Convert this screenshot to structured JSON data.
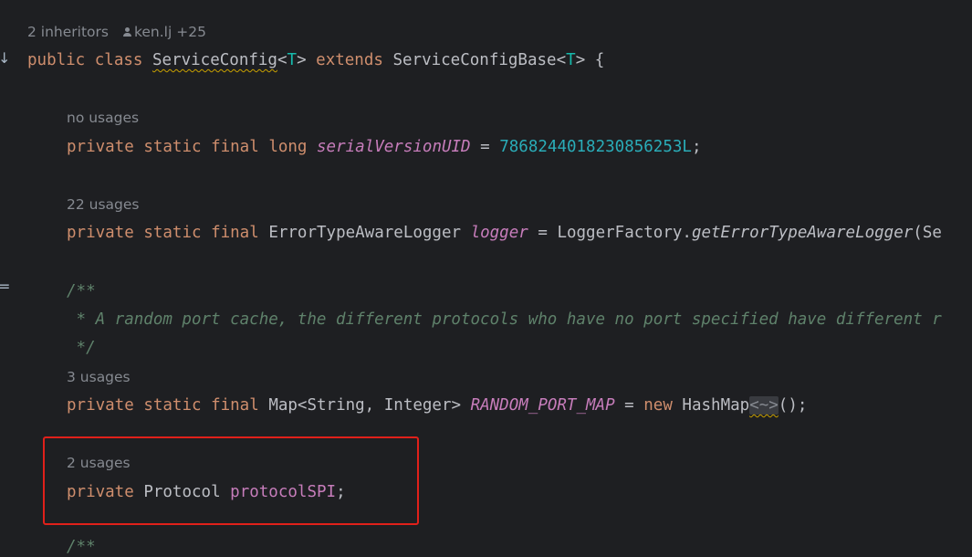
{
  "gutter": {
    "arrow_glyph": "↓",
    "impl_glyph": "="
  },
  "hints": {
    "inheritors": "2 inheritors",
    "author": "ken.lj +25",
    "usages_serial": "no usages",
    "usages_logger": "22 usages",
    "usages_map": "3 usages",
    "usages_protocol": "2 usages"
  },
  "code": {
    "class_decl": {
      "public": "public",
      "class": "class",
      "name": "ServiceConfig",
      "lt": "<",
      "tparam": "T",
      "gt": ">",
      "extends": "extends",
      "base": "ServiceConfigBase",
      "base_lt": "<",
      "base_tparam": "T",
      "base_gt": ">",
      "brace": "{"
    },
    "serial": {
      "private": "private",
      "static": "static",
      "final": "final",
      "type": "long",
      "name": "serialVersionUID",
      "eq": "=",
      "value": "7868244018230856253L",
      "semi": ";"
    },
    "logger": {
      "private": "private",
      "static": "static",
      "final": "final",
      "type": "ErrorTypeAwareLogger",
      "name": "logger",
      "eq": "=",
      "factory": "LoggerFactory",
      "dot": ".",
      "method": "getErrorTypeAwareLogger",
      "tail": "(Se"
    },
    "comment": {
      "open": "/**",
      "body": " * A random port cache, the different protocols who have no port specified have different r",
      "close": " */"
    },
    "map": {
      "private": "private",
      "static": "static",
      "final": "final",
      "type": "Map<String, Integer>",
      "name": "RANDOM_PORT_MAP",
      "eq": "=",
      "new": "new",
      "impl": "HashMap",
      "diamond": "<~>",
      "tail": "();"
    },
    "protocol": {
      "private": "private",
      "type": "Protocol",
      "name": "protocolSPI",
      "semi": ";"
    },
    "next_comment": "/**"
  },
  "colors": {
    "background": "#1e1f22",
    "keyword": "#cf8e6d",
    "field": "#c77dbb",
    "number": "#2aacb8",
    "comment": "#5f826b",
    "hint": "#868a91",
    "highlight_box": "#e0201a"
  }
}
